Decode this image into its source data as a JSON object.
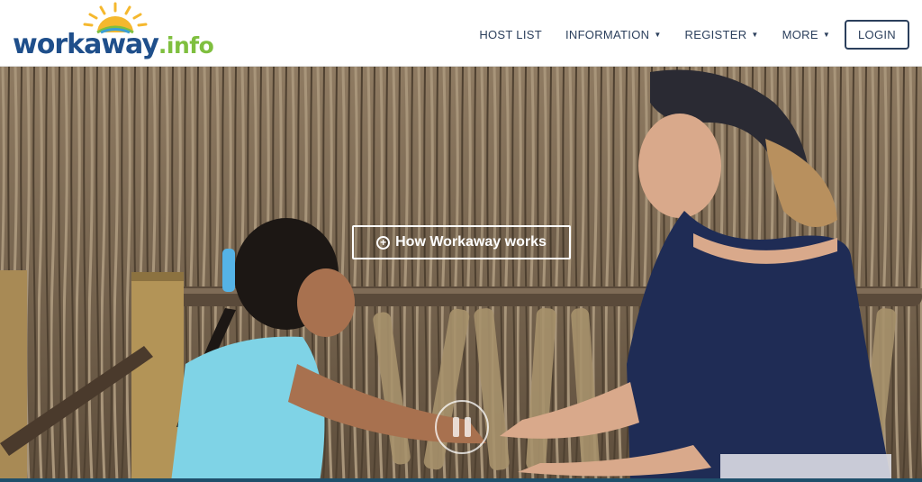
{
  "header": {
    "logo": {
      "main": "workaway",
      "ext": ".info",
      "icon": "sun-icon"
    },
    "nav": [
      {
        "label": "HOST LIST",
        "dropdown": false
      },
      {
        "label": "INFORMATION",
        "dropdown": true
      },
      {
        "label": "REGISTER",
        "dropdown": true
      },
      {
        "label": "MORE",
        "dropdown": true
      }
    ],
    "login_label": "LOGIN"
  },
  "hero": {
    "how_label": "How Workaway works",
    "how_icon": "plus-circle-icon",
    "pause_icon": "pause-icon"
  },
  "colors": {
    "brand_blue": "#1f4f8b",
    "brand_green": "#7fbf3f",
    "sun_yellow": "#f5b82e",
    "nav_text": "#2b3f5c"
  }
}
